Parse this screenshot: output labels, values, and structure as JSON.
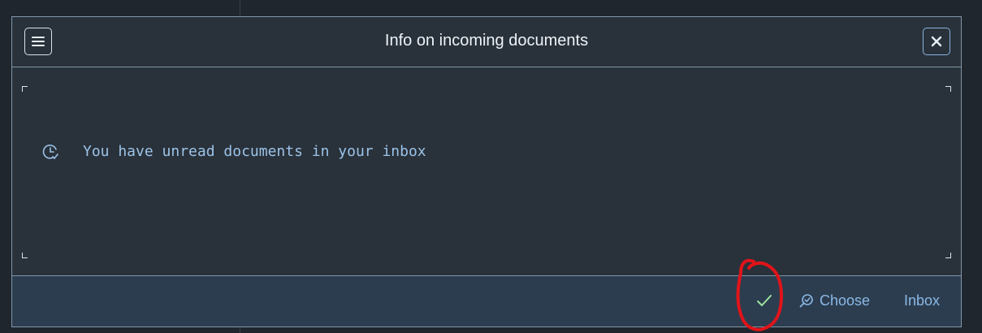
{
  "dialog": {
    "title": "Info on incoming documents",
    "message": "You have unread documents in your inbox",
    "icons": {
      "menu": "menu-icon",
      "close": "close-icon",
      "message": "clock-check-icon",
      "ok": "checkmark-icon",
      "choose": "zoom-check-icon"
    }
  },
  "footer": {
    "choose_label": "Choose",
    "inbox_label": "Inbox"
  },
  "colors": {
    "background": "#1f262e",
    "dialog_bg": "#29313a",
    "footer_bg": "#2c3d4f",
    "border": "#8396a8",
    "accent_text": "#8bb9e6",
    "check_green": "#9ee39a",
    "annotation_red": "#e0141a"
  }
}
